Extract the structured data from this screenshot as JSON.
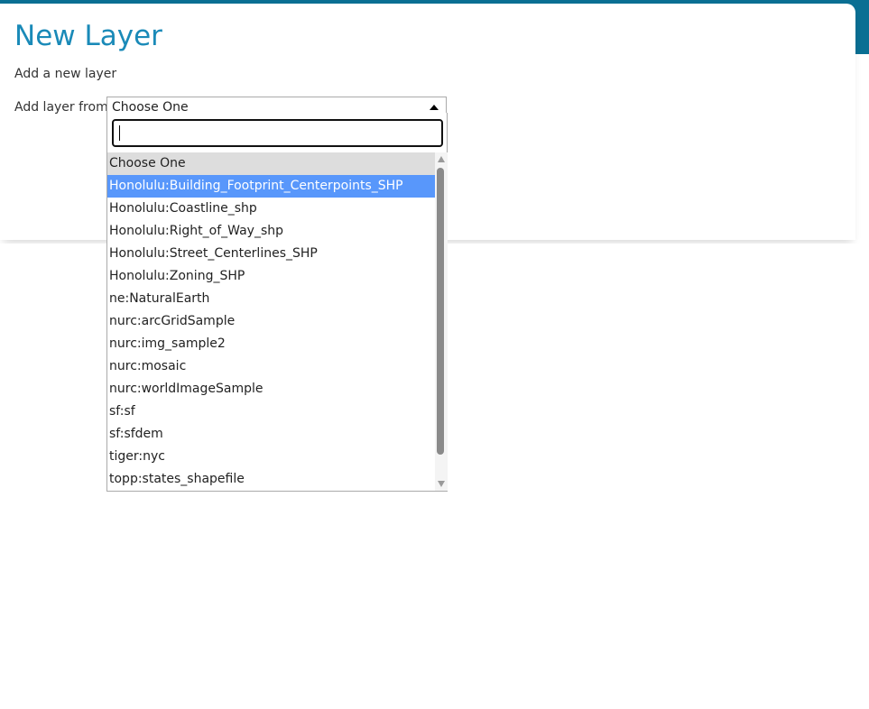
{
  "page": {
    "title": "New Layer",
    "subtitle": "Add a new layer"
  },
  "form": {
    "add_layer_label": "Add layer from",
    "selected_value": "Choose One",
    "search_value": ""
  },
  "dropdown": {
    "options": [
      "Choose One",
      "Honolulu:Building_Footprint_Centerpoints_SHP",
      "Honolulu:Coastline_shp",
      "Honolulu:Right_of_Way_shp",
      "Honolulu:Street_Centerlines_SHP",
      "Honolulu:Zoning_SHP",
      "ne:NaturalEarth",
      "nurc:arcGridSample",
      "nurc:img_sample2",
      "nurc:mosaic",
      "nurc:worldImageSample",
      "sf:sf",
      "sf:sfdem",
      "tiger:nyc",
      "topp:states_shapefile"
    ],
    "highlighted": "Honolulu:Building_Footprint_Centerpoints_SHP"
  },
  "icons": {
    "select_arrow": "triangle-up-icon",
    "scroll_up": "scroll-up-arrow-icon",
    "scroll_down": "scroll-down-arrow-icon"
  },
  "colors": {
    "header_band": "#0a6f93",
    "title": "#1a8ab8",
    "highlight": "#5897fb",
    "choose_bg": "#dddddd"
  }
}
